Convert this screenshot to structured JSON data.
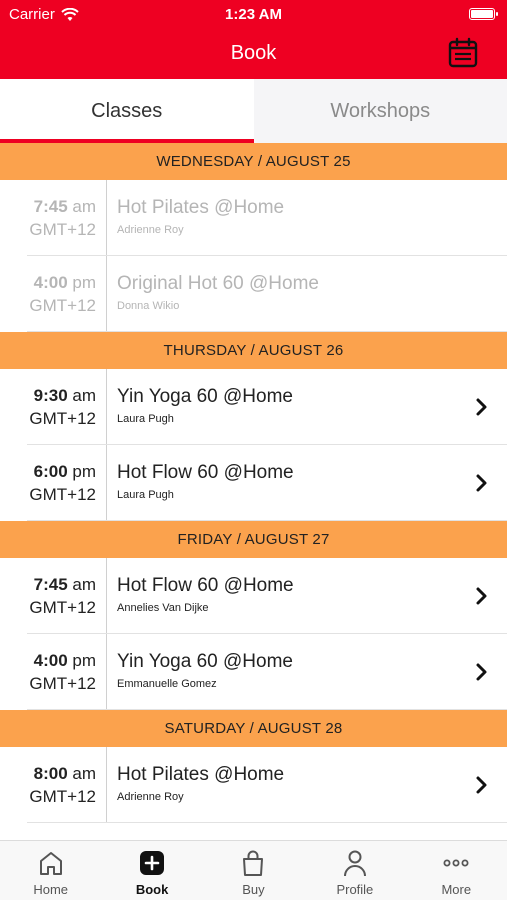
{
  "status": {
    "carrier": "Carrier",
    "time": "1:23 AM"
  },
  "nav": {
    "title": "Book",
    "calendar_icon": "calendar-icon"
  },
  "tabs": [
    {
      "label": "Classes",
      "active": true
    },
    {
      "label": "Workshops",
      "active": false
    }
  ],
  "days": [
    {
      "header": "WEDNESDAY / AUGUST 25",
      "classes": [
        {
          "time": "7:45",
          "ampm": "am",
          "tz": "GMT+12",
          "name": "Hot Pilates @Home",
          "teacher": "Adrienne Roy",
          "past": true
        },
        {
          "time": "4:00",
          "ampm": "pm",
          "tz": "GMT+12",
          "name": "Original Hot  60 @Home",
          "teacher": "Donna Wikio",
          "past": true
        }
      ]
    },
    {
      "header": "THURSDAY / AUGUST 26",
      "classes": [
        {
          "time": "9:30",
          "ampm": "am",
          "tz": "GMT+12",
          "name": "Yin Yoga 60  @Home",
          "teacher": "Laura Pugh",
          "past": false
        },
        {
          "time": "6:00",
          "ampm": "pm",
          "tz": "GMT+12",
          "name": "Hot Flow 60 @Home",
          "teacher": "Laura Pugh",
          "past": false
        }
      ]
    },
    {
      "header": "FRIDAY / AUGUST 27",
      "classes": [
        {
          "time": "7:45",
          "ampm": "am",
          "tz": "GMT+12",
          "name": "Hot Flow 60 @Home",
          "teacher": "Annelies Van Dijke",
          "past": false
        },
        {
          "time": "4:00",
          "ampm": "pm",
          "tz": "GMT+12",
          "name": "Yin Yoga 60  @Home",
          "teacher": "Emmanuelle Gomez",
          "past": false
        }
      ]
    },
    {
      "header": "SATURDAY / AUGUST 28",
      "classes": [
        {
          "time": "8:00",
          "ampm": "am",
          "tz": "GMT+12",
          "name": "Hot Pilates @Home",
          "teacher": "Adrienne Roy",
          "past": false
        }
      ]
    }
  ],
  "tabbar": [
    {
      "label": "Home",
      "icon": "home-icon",
      "active": false
    },
    {
      "label": "Book",
      "icon": "plus-square-icon",
      "active": true
    },
    {
      "label": "Buy",
      "icon": "shopping-bag-icon",
      "active": false
    },
    {
      "label": "Profile",
      "icon": "person-icon",
      "active": false
    },
    {
      "label": "More",
      "icon": "more-dots-icon",
      "active": false
    }
  ],
  "colors": {
    "brand_red": "#ee0022",
    "day_header": "#fba24d"
  }
}
